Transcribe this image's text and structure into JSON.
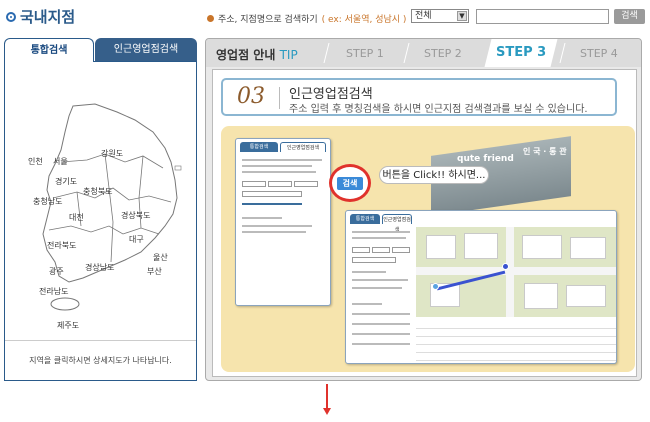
{
  "header": {
    "title": "국내지점",
    "search_hint_prefix": "주소, 지점명으로 검색하기",
    "search_hint_example": "( ex: 서울역, 성남시 )",
    "select_value": "전체",
    "search_button": "검색"
  },
  "tabs": [
    {
      "label": "통합검색",
      "active": true
    },
    {
      "label": "인근영업점검색",
      "active": false
    }
  ],
  "map": {
    "caption": "지역을 클릭하시면 상세지도가 나타납니다.",
    "regions": [
      "인천",
      "서울",
      "강원도",
      "경기도",
      "충청북도",
      "충청남도",
      "대전",
      "경상북도",
      "대구",
      "전라북도",
      "울산",
      "경상남도",
      "광주",
      "부산",
      "전라남도",
      "제주도"
    ]
  },
  "guide": {
    "label": "영업점 안내",
    "tip": "TIP",
    "steps": [
      "STEP 1",
      "STEP 2",
      "STEP 3",
      "STEP 4"
    ],
    "active_step": "STEP 3"
  },
  "step": {
    "number": "03",
    "title": "인근영업점검색",
    "description": "주소 입력 후 명칭검색을 하시면 인근지점 검색결과를 보실 수 있습니다."
  },
  "illustration": {
    "mini_tab_1": "통합검색",
    "mini_tab_2": "인근영업점검색",
    "callout_button": "검색",
    "speech_bubble": "버튼을 Click!! 하시면...",
    "building_sign": "qute friend",
    "building_sign_2": "인 국 · 통 관"
  },
  "colors": {
    "brand_blue": "#2a5a8a",
    "tip_blue": "#2a9ac0",
    "step_number": "#8b5a2b",
    "callout_red": "#e0322c",
    "illus_bg": "#f6e4ad"
  }
}
